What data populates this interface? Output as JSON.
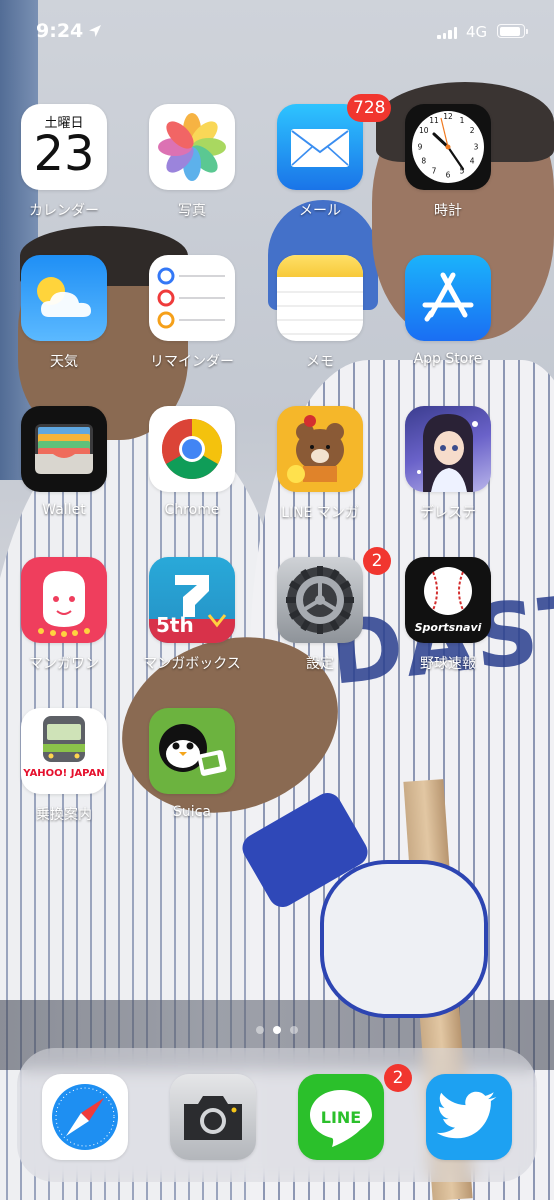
{
  "status_bar": {
    "time": "9:24",
    "network": "4G",
    "battery_level": 0.92
  },
  "home": {
    "rows": [
      [
        {
          "id": "calendar",
          "label": "カレンダー",
          "day": "土曜日",
          "date": "23"
        },
        {
          "id": "photos",
          "label": "写真"
        },
        {
          "id": "mail",
          "label": "メール",
          "badge": "728"
        },
        {
          "id": "clock",
          "label": "時計"
        }
      ],
      [
        {
          "id": "weather",
          "label": "天気"
        },
        {
          "id": "reminders",
          "label": "リマインダー"
        },
        {
          "id": "notes",
          "label": "メモ"
        },
        {
          "id": "appstore",
          "label": "App Store"
        }
      ],
      [
        {
          "id": "wallet",
          "label": "Wallet"
        },
        {
          "id": "chrome",
          "label": "Chrome"
        },
        {
          "id": "linemanga",
          "label": "LINE マンガ"
        },
        {
          "id": "deresute",
          "label": "デレステ"
        }
      ],
      [
        {
          "id": "mangaone",
          "label": "マンガワン",
          "icon_text": "マンガワン"
        },
        {
          "id": "mangabox",
          "label": "マンガボックス",
          "icon_text": "5th"
        },
        {
          "id": "settings",
          "label": "設定",
          "badge": "2"
        },
        {
          "id": "sportsnavi",
          "label": "野球速報",
          "icon_text": "Sportsnavi"
        }
      ],
      [
        {
          "id": "norikae",
          "label": "乗換案内",
          "icon_text": "YAHOO! JAPAN"
        },
        {
          "id": "suica",
          "label": "Suica"
        }
      ]
    ]
  },
  "page_indicator": {
    "count": 3,
    "active": 1
  },
  "dock": [
    {
      "id": "safari",
      "label": ""
    },
    {
      "id": "camera",
      "label": ""
    },
    {
      "id": "line",
      "label": "",
      "badge": "2",
      "icon_text": "LINE"
    },
    {
      "id": "twitter",
      "label": ""
    }
  ],
  "colors": {
    "badge": "#f1362f",
    "label": "#ffffff"
  }
}
